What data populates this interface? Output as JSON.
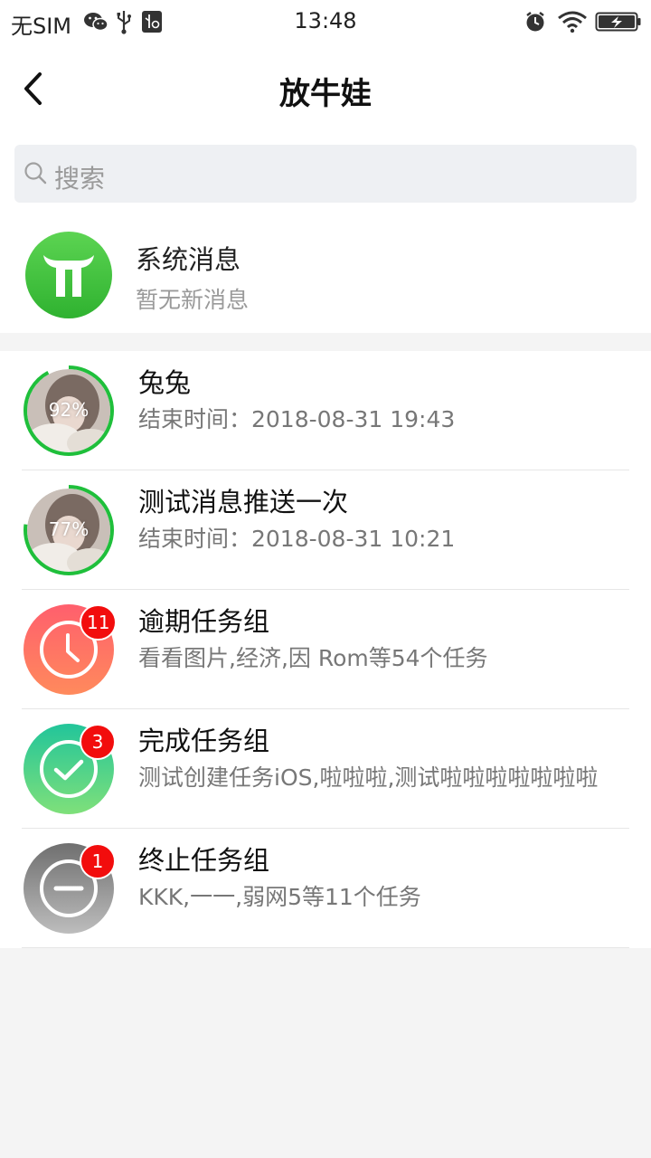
{
  "status_bar": {
    "carrier": "无SIM",
    "time": "13:48",
    "icons": [
      "wechat-icon",
      "usb-icon",
      "usb-debug-icon",
      "alarm-icon",
      "wifi-icon",
      "battery-charging-icon"
    ]
  },
  "nav": {
    "title": "放牛娃",
    "back_icon": "chevron-left-icon"
  },
  "search": {
    "placeholder": "搜索",
    "icon": "search-icon"
  },
  "system_message": {
    "title": "系统消息",
    "subtitle": "暂无新消息",
    "avatar_color": "#3cc13b"
  },
  "items": [
    {
      "title": "兔兔",
      "subtitle": "结束时间：2018-08-31 19:43",
      "progress_label": "92%",
      "progress": 0.92
    },
    {
      "title": "测试消息推送一次",
      "subtitle": "结束时间：2018-08-31 10:21",
      "progress_label": "77%",
      "progress": 0.77
    },
    {
      "title": "逾期任务组",
      "subtitle": "看看图片,经济,因 Rom等54个任务",
      "badge": "11",
      "icon": "clock-icon",
      "colors": [
        "#ff5f6d",
        "#ff8a5c"
      ]
    },
    {
      "title": "完成任务组",
      "subtitle": "测试创建任务iOS,啦啦啦,测试啦啦啦啦啦啦啦",
      "badge": "3",
      "icon": "check-icon",
      "colors": [
        "#22c59a",
        "#7fe07a"
      ]
    },
    {
      "title": "终止任务组",
      "subtitle": "KKK,一一,弱网5等11个任务",
      "badge": "1",
      "icon": "minus-circle-icon",
      "colors": [
        "#6f6f6f",
        "#bdbdbd"
      ]
    }
  ],
  "colors": {
    "progress_ring": "#1fbf3b",
    "badge": "#f20d0d"
  }
}
